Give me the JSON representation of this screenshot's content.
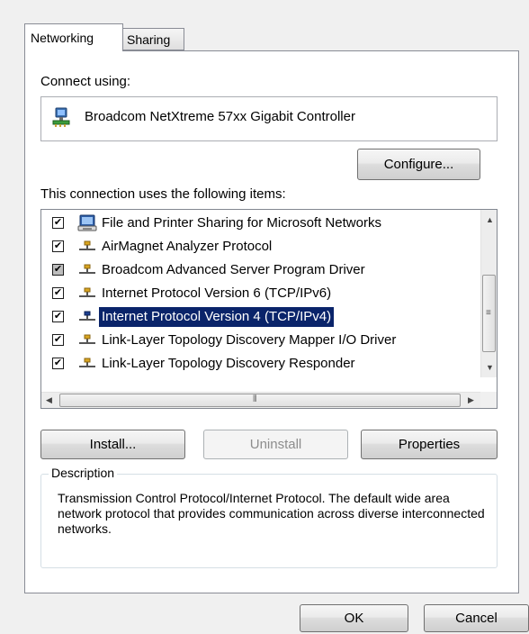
{
  "tabs": [
    {
      "label": "Networking",
      "selected": true
    },
    {
      "label": "Sharing",
      "selected": false
    }
  ],
  "connect_using": {
    "label": "Connect using:",
    "adapter": "Broadcom NetXtreme 57xx Gigabit Controller",
    "adapter_icon": "network-adapter-icon"
  },
  "configure_label": "Configure...",
  "items_label": "This connection uses the following items:",
  "items": [
    {
      "label": "File and Printer Sharing for Microsoft Networks",
      "checked": true,
      "grayed": false,
      "icon": "printer-service-icon",
      "selected": false
    },
    {
      "label": "AirMagnet Analyzer Protocol",
      "checked": true,
      "grayed": false,
      "icon": "protocol-icon",
      "selected": false
    },
    {
      "label": "Broadcom Advanced Server Program Driver",
      "checked": true,
      "grayed": true,
      "icon": "protocol-icon",
      "selected": false
    },
    {
      "label": "Internet Protocol Version 6 (TCP/IPv6)",
      "checked": true,
      "grayed": false,
      "icon": "protocol-icon",
      "selected": false
    },
    {
      "label": "Internet Protocol Version 4 (TCP/IPv4)",
      "checked": true,
      "grayed": false,
      "icon": "protocol-icon",
      "selected": true
    },
    {
      "label": "Link-Layer Topology Discovery Mapper I/O Driver",
      "checked": true,
      "grayed": false,
      "icon": "protocol-icon",
      "selected": false
    },
    {
      "label": "Link-Layer Topology Discovery Responder",
      "checked": true,
      "grayed": false,
      "icon": "protocol-icon",
      "selected": false
    }
  ],
  "buttons": {
    "install": "Install...",
    "uninstall": "Uninstall",
    "properties": "Properties",
    "ok": "OK",
    "cancel": "Cancel"
  },
  "description": {
    "title": "Description",
    "text": "Transmission Control Protocol/Internet Protocol. The default wide area network protocol that provides communication across diverse interconnected networks."
  },
  "colors": {
    "selection": "#0a246a",
    "window_bg": "#f0f0f0"
  }
}
